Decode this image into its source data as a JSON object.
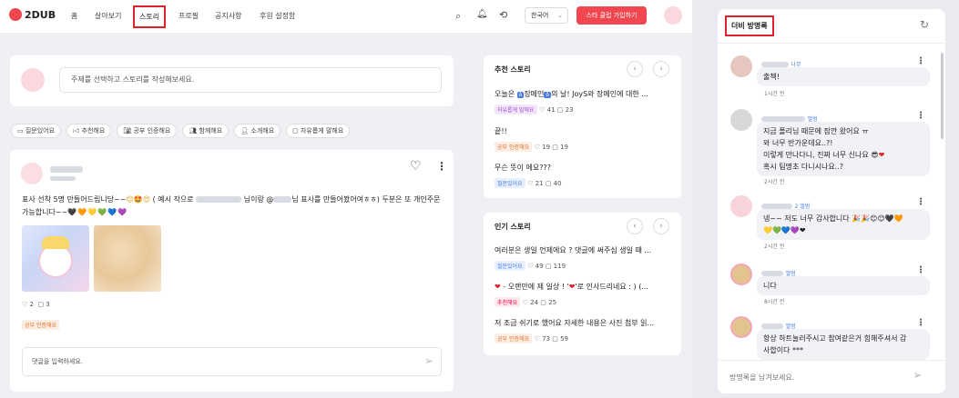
{
  "header": {
    "logo": "2DUB",
    "nav": [
      "홈",
      "살아보기",
      "스토리",
      "프로필",
      "공지사항",
      "후원 설정함"
    ],
    "lang": "한국어",
    "cta": "스타 클럽 가입하기"
  },
  "composer": {
    "placeholder": "주제를 선택하고 스토리를 작성해보세요."
  },
  "filters": [
    "질문있어요",
    "추천해요",
    "공부 인증해요",
    "함께해요",
    "소개해요",
    "자유롭게 말해요"
  ],
  "post": {
    "text_part1": "표사 선착 5명 만들어드립니당~~",
    "text_part2": "( 예시 작으로",
    "text_part3": "님이랑 @",
    "text_part4": "님 표사를 만들어봤어여ㅎㅎ) 두분은 또 개인주문가능합니다~~",
    "likes": "2",
    "comments": "3",
    "tag": "공부 인증해요",
    "comment_placeholder": "댓글을 입력하세요."
  },
  "recommended": {
    "title": "추천 스토리",
    "items": [
      {
        "pre": "오늘은",
        "mid1": "장메인",
        "mid2": "의 날! JoyS와 장메인에 대한 ...",
        "tag": "자유롭게 말해요",
        "likes": "41",
        "comments": "23"
      },
      {
        "title": "끝!!",
        "tag": "공부 인증해요",
        "likes": "19",
        "comments": "19"
      },
      {
        "title": "무슨 뜻이 에요???",
        "tag": "질문있어요",
        "likes": "21",
        "comments": "40"
      }
    ]
  },
  "popular": {
    "title": "인기 스토리",
    "items": [
      {
        "title": "여러분은 생일 언제에요 ? 댓글에 써주심 생일 때 ...",
        "tag": "질문있어요",
        "likes": "49",
        "comments": "119"
      },
      {
        "title": "- 오랜만에 제 일상 ! '",
        "title2": "'로 인사드리네요 : ) (...",
        "tag": "추천해요",
        "likes": "24",
        "comments": "25"
      },
      {
        "title": "저 조금 쉬기로 했어요 자세한 내용은 사진 첨부 읽...",
        "tag": "공부 인증해요",
        "likes": "73",
        "comments": "59"
      }
    ]
  },
  "guestbook": {
    "title": "더비 방명록",
    "placeholder": "방명록을 남겨보세요.",
    "entries": [
      {
        "name": "나무",
        "text1": "출첵!",
        "time": "1시간 전"
      },
      {
        "name": "앨범",
        "text1": "지금 폴리님 때문에 잠깐 왔어요 ㅠ",
        "text2": "와 너무 반가운데요..?!",
        "text3": "이렇게 만나다니, 진짜 너무 신나요",
        "text4": "혹시 팀명초 다니시나요..?",
        "time": "2시간 전"
      },
      {
        "name": "2 앨범",
        "text1": "넹~~ 저도 너무 감사합니다",
        "time": "2시간 전"
      },
      {
        "name": "앨범",
        "text1": "니다",
        "time": "8시간 전"
      },
      {
        "name": "앨범",
        "text1": "항상 하트눌러주시고 참여같은거 힘해주셔서 감",
        "text2": "사합이다 ***",
        "time": ""
      }
    ]
  },
  "colors": {
    "accent": "#f0464f",
    "highlight_box": "#e0212a",
    "blue": "#4a7be0"
  }
}
